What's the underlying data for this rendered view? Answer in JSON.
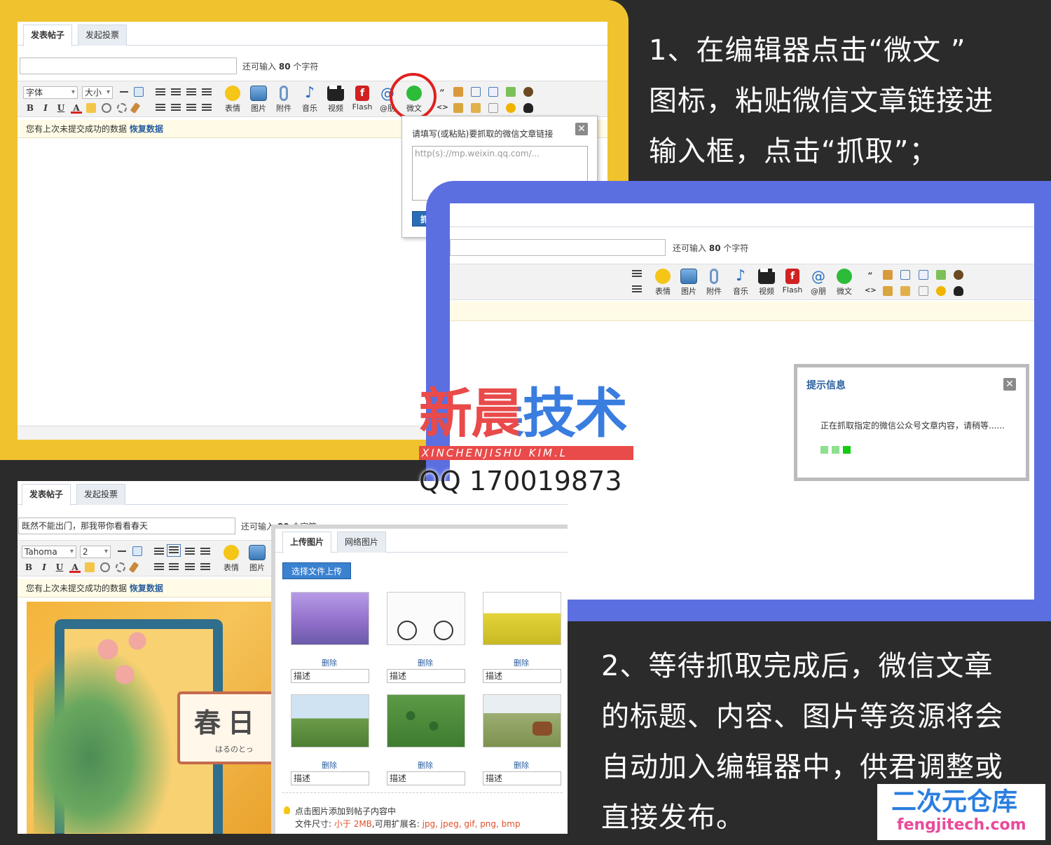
{
  "colors": {
    "yellow_frame": "#f0c22e",
    "blue_frame": "#5b6fe0",
    "background": "#2b2b2b",
    "link_blue": "#2b5f9f",
    "wechat_green": "#2dbb3a",
    "highlight_red": "#e02020"
  },
  "panel1": {
    "tabs": [
      "发表帖子",
      "发起投票"
    ],
    "counter_prefix": "还可输入",
    "counter_value": "80",
    "counter_suffix": "个字符",
    "font_select": "字体",
    "size_select": "大小",
    "toolbar": [
      "表情",
      "图片",
      "附件",
      "音乐",
      "视频",
      "Flash",
      "@朋",
      "微文"
    ],
    "notice": "您有上次未提交成功的数据",
    "notice_link": "恢复数据",
    "popup": {
      "label": "请填写(或粘贴)要抓取的微信文章链接",
      "placeholder": "http(s)://mp.weixin.qq.com/...",
      "button": "抓取",
      "close": "✕"
    }
  },
  "panel2": {
    "counter_prefix": "还可输入",
    "counter_value": "80",
    "counter_suffix": "个字符",
    "toolbar": [
      "表情",
      "图片",
      "附件",
      "音乐",
      "视频",
      "Flash",
      "@朋",
      "微文"
    ],
    "dialog": {
      "title": "提示信息",
      "message": "正在抓取指定的微信公众号文章内容，请稍等......",
      "close": "✕"
    }
  },
  "panel3": {
    "tabs": [
      "发表帖子",
      "发起投票"
    ],
    "title_value": "既然不能出门，那我带你看看春天",
    "counter_prefix": "还可输入",
    "counter_value": "80",
    "counter_suffix": "个字符",
    "font_select": "Tahoma",
    "size_select": "2",
    "toolbar": [
      "表情",
      "图片"
    ],
    "notice": "您有上次未提交成功的数据",
    "notice_link": "恢复数据",
    "image_text_big": "春日",
    "image_text_small": "はるのとっ",
    "upload": {
      "tabs": [
        "上传图片",
        "网络图片"
      ],
      "button": "选择文件上传",
      "delete_label": "删除",
      "desc_placeholder": "描述",
      "hint": "点击图片添加到帖子内容中",
      "size_label": "文件尺寸:",
      "size_value": "小于 2MB",
      "ext_label": ",可用扩展名:",
      "ext_value": "jpg, jpeg, gif, png, bmp"
    }
  },
  "captions": {
    "step1": [
      "1、在编辑器点击“微文 ”",
      "图标，粘贴微信文章链接进",
      "输入框，点击“抓取”；"
    ],
    "step2": [
      "2、等待抓取完成后，微信文章",
      "的标题、内容、图片等资源将会",
      "自动加入编辑器中，供君调整或",
      "直接发布。"
    ]
  },
  "watermark": {
    "title": "新晨技术",
    "subtitle_left": "XINCHENJISHU",
    "subtitle_right": "KIM.L",
    "qq": "QQ 170019873"
  },
  "corner_logo": {
    "title": "二次元仓库",
    "domain": "fengjitech.com"
  }
}
